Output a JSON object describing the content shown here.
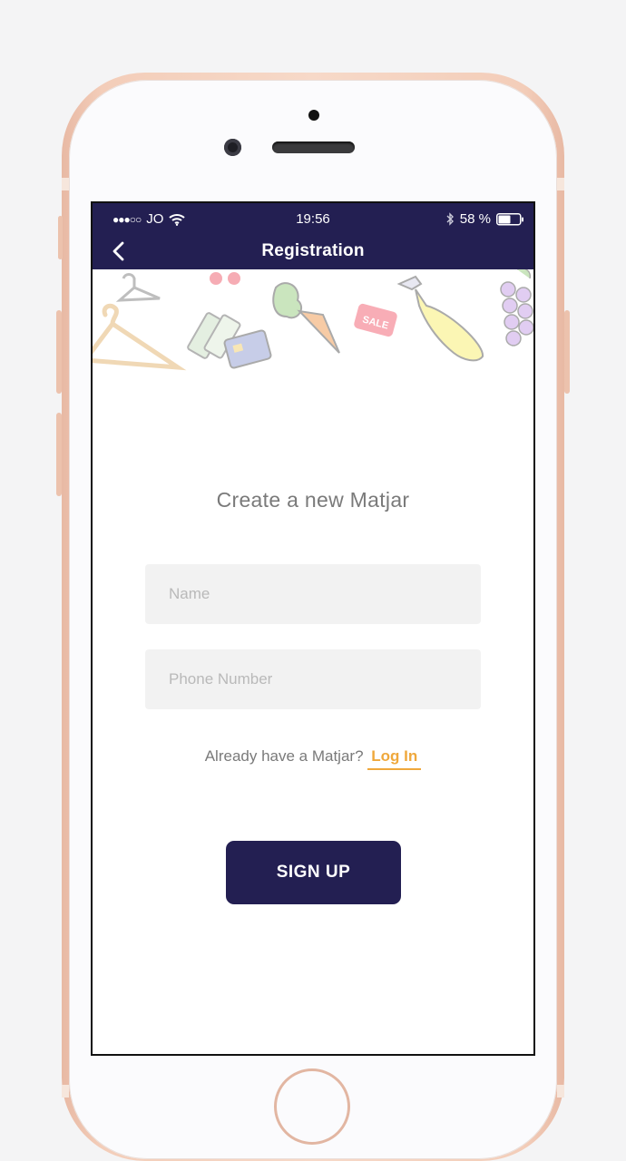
{
  "status_bar": {
    "signal": "●●●○○",
    "carrier": "JO",
    "time": "19:56",
    "battery_percent": "58 %",
    "battery_level": 0.58
  },
  "nav": {
    "back_icon": "chevron-left-icon",
    "title": "Registration"
  },
  "form": {
    "heading": "Create a new Matjar",
    "name": {
      "value": "",
      "placeholder": "Name"
    },
    "phone": {
      "value": "",
      "placeholder": "Phone Number"
    },
    "login_prompt": "Already have a Matjar?",
    "login_link": "Log In",
    "submit_label": "SIGN UP"
  },
  "decor_tag_text": "SALE",
  "colors": {
    "header": "#231f52",
    "accent": "#efa83c",
    "field_bg": "#f2f2f2",
    "heading_text": "#7a7a7a"
  }
}
